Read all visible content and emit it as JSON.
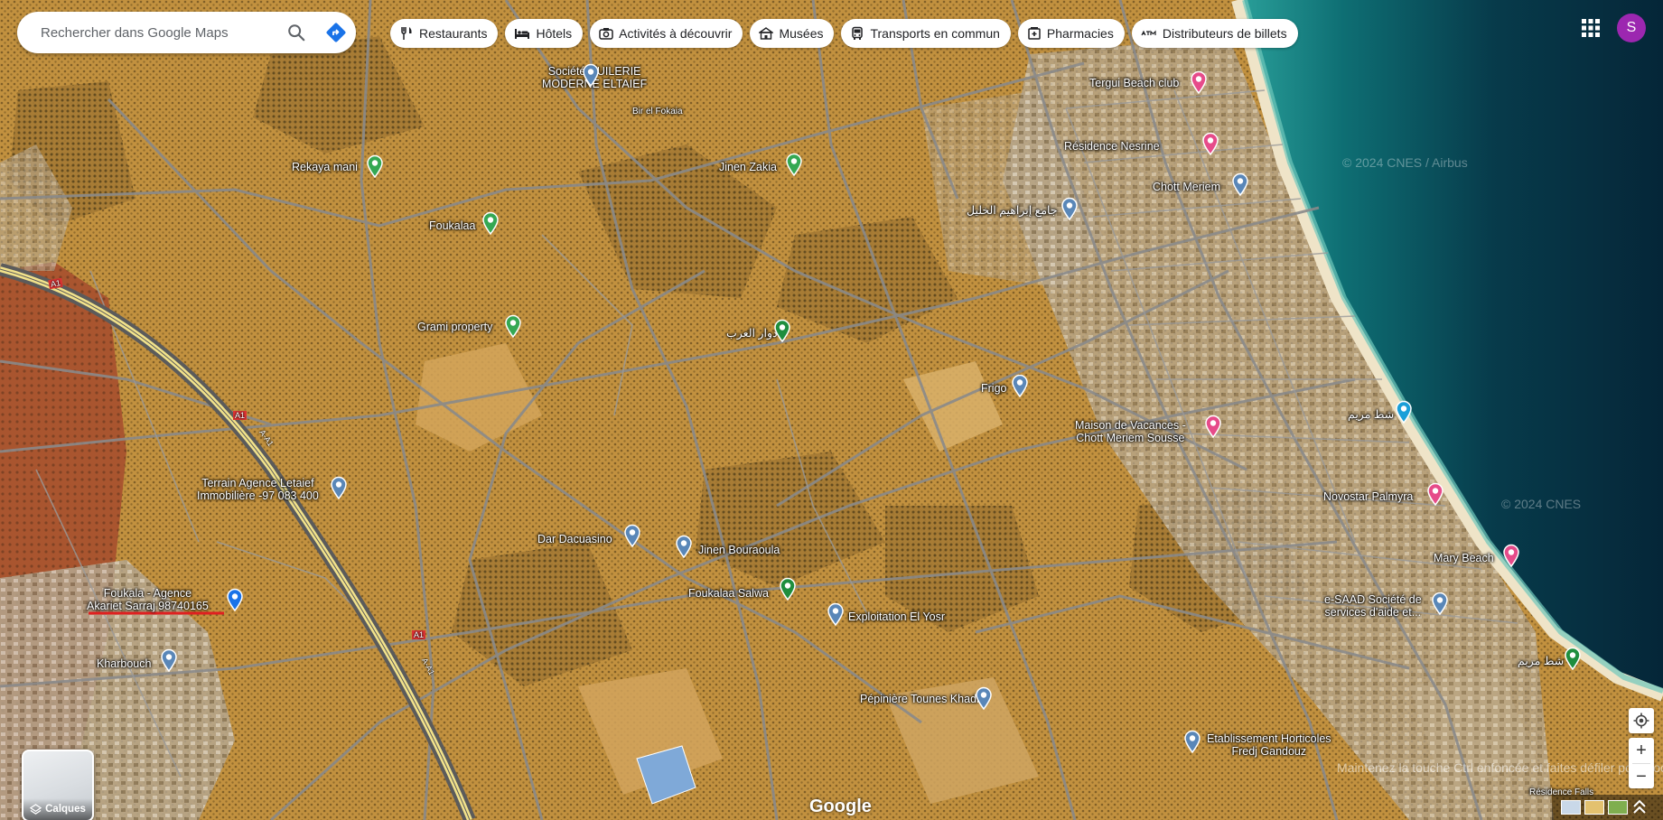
{
  "search": {
    "placeholder": "Rechercher dans Google Maps"
  },
  "chips": [
    {
      "label": "Restaurants",
      "icon": "fork-knife-icon"
    },
    {
      "label": "Hôtels",
      "icon": "bed-icon"
    },
    {
      "label": "Activités à découvrir",
      "icon": "camera-icon"
    },
    {
      "label": "Musées",
      "icon": "museum-icon"
    },
    {
      "label": "Transports en commun",
      "icon": "bus-icon"
    },
    {
      "label": "Pharmacies",
      "icon": "pharmacy-icon"
    },
    {
      "label": "Distributeurs de billets",
      "icon": "atm-icon"
    }
  ],
  "account": {
    "initial": "S",
    "color": "#9c27b0"
  },
  "roads": [
    {
      "label": "A1"
    },
    {
      "label": "A1"
    },
    {
      "label": "A1"
    },
    {
      "label": "A-A1"
    },
    {
      "label": "A-A1"
    }
  ],
  "places": [
    {
      "name": "Société HUILERIE\nMODERNE ELTAIEF",
      "type": "place"
    },
    {
      "name": "Bir el Fokaia",
      "type": "text"
    },
    {
      "name": "Tergui Beach club",
      "type": "hotel"
    },
    {
      "name": "Résidence Nesrine",
      "type": "hotel"
    },
    {
      "name": "Chott Meriem",
      "type": "place"
    },
    {
      "name": "Rekaya mani",
      "type": "park"
    },
    {
      "name": "Jinen Zakia",
      "type": "park"
    },
    {
      "name": "جامع إبراهيم الخليل",
      "type": "mosque"
    },
    {
      "name": "Foukalaa",
      "type": "park"
    },
    {
      "name": "Grami property",
      "type": "park"
    },
    {
      "name": "دوار العرب",
      "type": "tree"
    },
    {
      "name": "Frigo",
      "type": "building"
    },
    {
      "name": "شط مريم",
      "type": "camera"
    },
    {
      "name": "Maison de Vacances -\nChott Meriem Sousse",
      "type": "hotel"
    },
    {
      "name": "Terrain Agence Letaief\nImmobilière -97 083 400",
      "type": "place"
    },
    {
      "name": "Novostar Palmyra",
      "type": "hotel"
    },
    {
      "name": "Dar Dacuasino",
      "type": "place"
    },
    {
      "name": "Jinen Bouraoula",
      "type": "place"
    },
    {
      "name": "Mary Beach",
      "type": "beach"
    },
    {
      "name": "Foukala - Agence\nAkariet Sarraj 98740165",
      "type": "flag"
    },
    {
      "name": "Foukalaa Salwa",
      "type": "tree"
    },
    {
      "name": "e-SAAD Société de\nservices d'aide et...",
      "type": "place"
    },
    {
      "name": "Exploitation El Yosr",
      "type": "place"
    },
    {
      "name": "Kharbouch",
      "type": "place"
    },
    {
      "name": "شط مريم",
      "type": "hiking"
    },
    {
      "name": "Pépinière Tounes Khadra",
      "type": "place"
    },
    {
      "name": "Etablissement Horticoles\nFredj Gandouz",
      "type": "place"
    },
    {
      "name": "Résidence Falls",
      "type": "text"
    }
  ],
  "layers": {
    "label": "Calques"
  },
  "branding": {
    "logo": "Google"
  },
  "watermarks": [
    {
      "text": "© 2024 CNES / Airbus"
    },
    {
      "text": "© 2024 CNES"
    }
  ],
  "hint": "Maintenez la touche Ctrl enfoncée et faites défiler pour zoomer...",
  "controls": {
    "zoom_in": "+",
    "zoom_out": "−"
  }
}
